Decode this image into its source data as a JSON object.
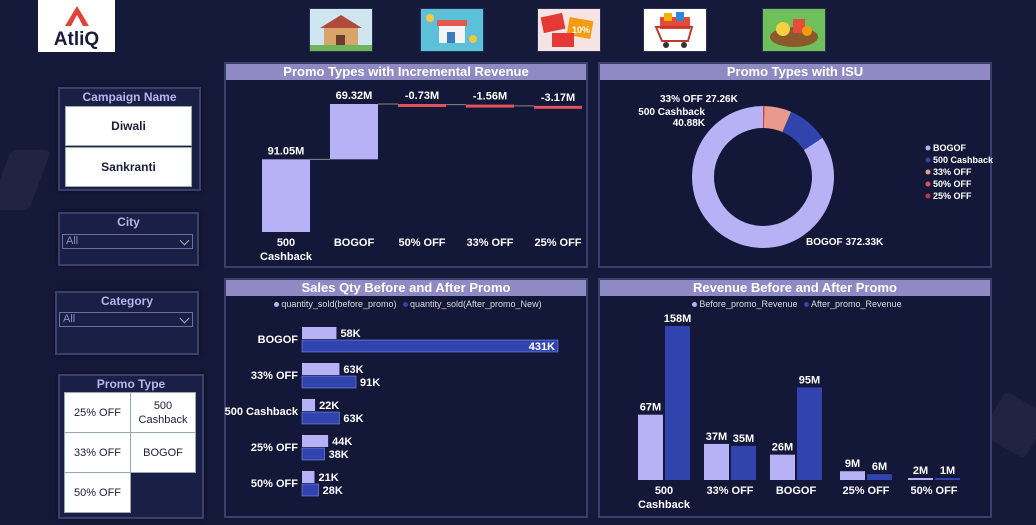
{
  "logo": {
    "brand": "AtliQ"
  },
  "thumbnails": [
    "house-icon",
    "shop-icon",
    "sale-tag-icon",
    "shopping-cart-icon",
    "groceries-icon"
  ],
  "slicers": {
    "campaign": {
      "title": "Campaign Name",
      "options": [
        "Diwali",
        "Sankranti"
      ]
    },
    "city": {
      "title": "City",
      "value": "All"
    },
    "category": {
      "title": "Category",
      "value": "All"
    },
    "promo": {
      "title": "Promo Type",
      "options": [
        "25% OFF",
        "500 Cashback",
        "33% OFF",
        "BOGOF",
        "50% OFF"
      ]
    }
  },
  "colors": {
    "background": "#161a3a",
    "light_bar": "#b7b1f5",
    "dark_bar": "#3144ae",
    "negative_bar": "#e0525c",
    "title_bar": "#8f8ac4"
  },
  "chart_data": [
    {
      "type": "bar",
      "subtype": "waterfall",
      "title": "Promo Types with Incremental Revenue",
      "categories": [
        "500 Cashback",
        "BOGOF",
        "50% OFF",
        "33% OFF",
        "25% OFF"
      ],
      "values": [
        91.05,
        69.32,
        -0.73,
        -1.56,
        -3.17
      ],
      "labels": [
        "91.05M",
        "69.32M",
        "-0.73M",
        "-1.56M",
        "-3.17M"
      ],
      "unit": "M"
    },
    {
      "type": "pie",
      "subtype": "donut",
      "title": "Promo Types with ISU",
      "slices": [
        {
          "name": "BOGOF",
          "value": 372.33,
          "label": "BOGOF 372.33K",
          "color": "#b7b1f5"
        },
        {
          "name": "500 Cashback",
          "value": 40.88,
          "label": "500 Cashback 40.88K",
          "color": "#3144ae"
        },
        {
          "name": "33% OFF",
          "value": 27.26,
          "label": "33% OFF 27.26K",
          "color": "#e89a8c"
        },
        {
          "name": "50% OFF",
          "value": 0.8,
          "label": "",
          "color": "#e0525c"
        },
        {
          "name": "25% OFF",
          "value": 0.5,
          "label": "",
          "color": "#c7304a"
        }
      ],
      "legend": "right"
    },
    {
      "type": "bar",
      "orientation": "horizontal",
      "title": "Sales Qty Before and After Promo",
      "categories": [
        "BOGOF",
        "33% OFF",
        "500 Cashback",
        "25% OFF",
        "50% OFF"
      ],
      "series": [
        {
          "name": "quantity_sold(before_promo)",
          "values": [
            58,
            63,
            22,
            44,
            21
          ],
          "labels": [
            "58K",
            "63K",
            "22K",
            "44K",
            "21K"
          ]
        },
        {
          "name": "quantity_sold(After_promo_New)",
          "values": [
            431,
            91,
            63,
            38,
            28
          ],
          "labels": [
            "431K",
            "91K",
            "63K",
            "38K",
            "28K"
          ]
        }
      ],
      "legend": "top"
    },
    {
      "type": "bar",
      "title": "Revenue Before and After Promo",
      "categories": [
        "500 Cashback",
        "33% OFF",
        "BOGOF",
        "25% OFF",
        "50% OFF"
      ],
      "series": [
        {
          "name": "Before_promo_Revenue",
          "values": [
            67,
            37,
            26,
            9,
            2
          ],
          "labels": [
            "67M",
            "37M",
            "26M",
            "9M",
            "2M"
          ]
        },
        {
          "name": "After_promo_Revenue",
          "values": [
            158,
            35,
            95,
            6,
            1
          ],
          "labels": [
            "158M",
            "35M",
            "95M",
            "6M",
            "1M"
          ]
        }
      ],
      "legend": "top"
    }
  ]
}
